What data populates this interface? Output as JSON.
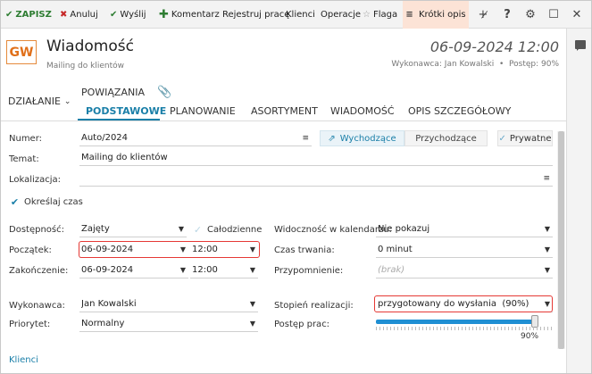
{
  "toolbar": {
    "save": "ZAPISZ",
    "cancel": "Anuluj",
    "send": "Wyślij",
    "comment": "Komentarz",
    "register_work": "Rejestruj pracę",
    "clients": "Klienci",
    "operations": "Operacje",
    "flag": "Flaga",
    "short_desc": "Krótki opis",
    "icons": [
      "plus-x-icon",
      "help-icon",
      "gear-icon",
      "maximize-icon",
      "close-icon"
    ],
    "accent_save": "#2e7d32",
    "accent_short_bg": "#fce3d6"
  },
  "header": {
    "logo": "GW",
    "title": "Wiadomość",
    "subtitle": "Mailing do klientów",
    "date": "06-09-2024 12:00",
    "meta": "Wykonawca: Jan Kowalski  •  Postęp: 90%"
  },
  "tabs": {
    "action": "DZIAŁANIE",
    "links": "POWIĄZANIA",
    "items": [
      "PODSTAWOWE",
      "PLANOWANIE",
      "ASORTYMENT",
      "WIADOMOŚĆ",
      "OPIS SZCZEGÓŁOWY"
    ],
    "active_color": "#1a7fa8"
  },
  "form": {
    "number_label": "Numer:",
    "number_value": "Auto/2024",
    "direction_out": "Wychodzące",
    "direction_in": "Przychodzące",
    "private_label": "Prywatne",
    "subject_label": "Temat:",
    "subject_value": "Mailing do klientów",
    "location_label": "Lokalizacja:",
    "location_value": "",
    "specify_time_label": "Określaj czas",
    "availability_label": "Dostępność:",
    "availability_value": "Zajęty",
    "all_day_label": "Całodzienne",
    "start_label": "Początek:",
    "start_date": "06-09-2024",
    "start_time": "12:00",
    "end_label": "Zakończenie:",
    "end_date": "06-09-2024",
    "end_time": "12:00",
    "calendar_visibility_label": "Widoczność w kalendarzu:",
    "calendar_visibility_value": "Nie pokazuj",
    "duration_label": "Czas trwania:",
    "duration_value": "0 minut",
    "reminder_label": "Przypomnienie:",
    "reminder_placeholder": "(brak)",
    "executor_label": "Wykonawca:",
    "executor_value": "Jan Kowalski",
    "priority_label": "Priorytet:",
    "priority_value": "Normalny",
    "status_label": "Stopień realizacji:",
    "status_value": "przygotowany do wysłania  (90%)",
    "progress_label": "Postęp prac:",
    "progress_percent": "90%",
    "progress_fraction": 0.9,
    "highlight_color": "#e53935"
  },
  "footer": {
    "clients_link": "Klienci"
  }
}
